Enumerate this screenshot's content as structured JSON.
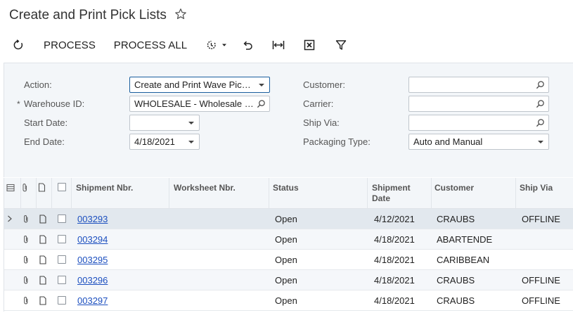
{
  "page": {
    "title": "Create and Print Pick Lists"
  },
  "toolbar": {
    "process_label": "PROCESS",
    "process_all_label": "PROCESS ALL"
  },
  "filters": {
    "action": {
      "label": "Action:",
      "value": "Create and Print Wave Pick..."
    },
    "warehouse": {
      "label": "Warehouse ID:",
      "required_marker": "*",
      "value": "WHOLESALE - Wholesale W..."
    },
    "start_date": {
      "label": "Start Date:",
      "value": ""
    },
    "end_date": {
      "label": "End Date:",
      "value": "4/18/2021"
    },
    "customer": {
      "label": "Customer:",
      "value": ""
    },
    "carrier": {
      "label": "Carrier:",
      "value": ""
    },
    "ship_via": {
      "label": "Ship Via:",
      "value": ""
    },
    "packaging_type": {
      "label": "Packaging Type:",
      "value": "Auto and Manual"
    }
  },
  "grid": {
    "columns": {
      "shipment_nbr": "Shipment Nbr.",
      "worksheet_nbr": "Worksheet Nbr.",
      "status": "Status",
      "shipment_date_line1": "Shipment",
      "shipment_date_line2": "Date",
      "customer": "Customer",
      "ship_via": "Ship Via"
    },
    "rows": [
      {
        "shipment_nbr": "003293",
        "worksheet_nbr": "",
        "status": "Open",
        "shipment_date": "4/12/2021",
        "customer": "CRAUBS",
        "ship_via": "OFFLINE"
      },
      {
        "shipment_nbr": "003294",
        "worksheet_nbr": "",
        "status": "Open",
        "shipment_date": "4/18/2021",
        "customer": "ABARTENDE",
        "ship_via": ""
      },
      {
        "shipment_nbr": "003295",
        "worksheet_nbr": "",
        "status": "Open",
        "shipment_date": "4/18/2021",
        "customer": "CARIBBEAN",
        "ship_via": ""
      },
      {
        "shipment_nbr": "003296",
        "worksheet_nbr": "",
        "status": "Open",
        "shipment_date": "4/18/2021",
        "customer": "CRAUBS",
        "ship_via": "OFFLINE"
      },
      {
        "shipment_nbr": "003297",
        "worksheet_nbr": "",
        "status": "Open",
        "shipment_date": "4/18/2021",
        "customer": "CRAUBS",
        "ship_via": "OFFLINE"
      }
    ]
  },
  "colors": {
    "accent": "#1a5f9e",
    "link": "#1c4fbf",
    "panel_bg": "#f3f6f9",
    "selected_row": "#e2e8ee"
  },
  "icons": [
    "star-icon",
    "refresh-icon",
    "schedule-icon",
    "undo-icon",
    "fit-columns-icon",
    "excel-export-icon",
    "filter-icon",
    "search-icon",
    "attachment-icon",
    "note-icon"
  ]
}
